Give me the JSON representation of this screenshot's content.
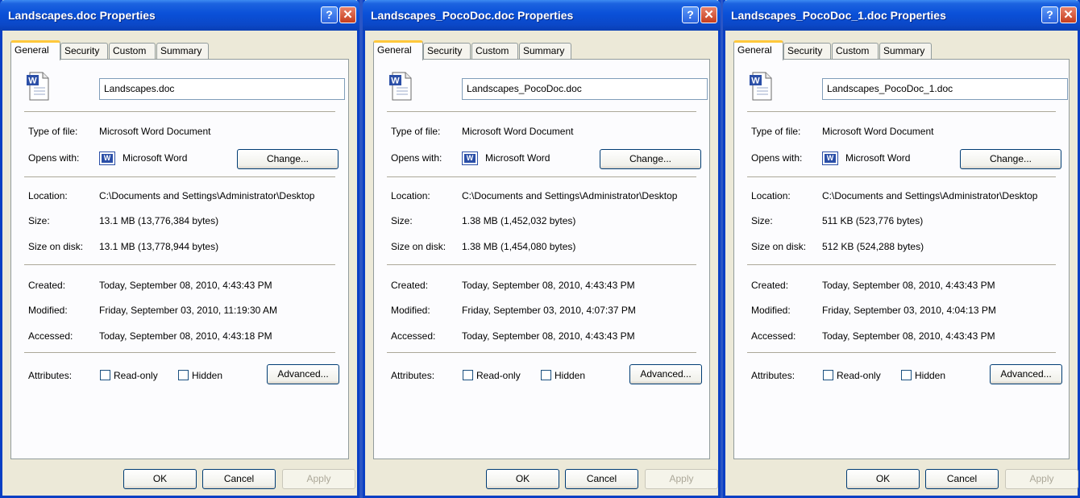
{
  "dialogs": [
    {
      "title": "Landscapes.doc Properties",
      "tabs": [
        "General",
        "Security",
        "Custom",
        "Summary"
      ],
      "file_name": "Landscapes.doc",
      "labels": {
        "type": "Type of file:",
        "opens": "Opens with:",
        "location": "Location:",
        "size": "Size:",
        "size_on_disk": "Size on disk:",
        "created": "Created:",
        "modified": "Modified:",
        "accessed": "Accessed:",
        "attributes": "Attributes:"
      },
      "type_of_file": "Microsoft Word Document",
      "opens_with": "Microsoft Word",
      "change_button": "Change...",
      "location": "C:\\Documents and Settings\\Administrator\\Desktop",
      "size": "13.1 MB (13,776,384 bytes)",
      "size_on_disk": "13.1 MB (13,778,944 bytes)",
      "created": "Today, September 08, 2010, 4:43:43 PM",
      "modified": "Friday, September 03, 2010, 11:19:30 AM",
      "accessed": "Today, September 08, 2010, 4:43:18 PM",
      "readonly_label": "Read-only",
      "hidden_label": "Hidden",
      "advanced_button": "Advanced...",
      "ok": "OK",
      "cancel": "Cancel",
      "apply": "Apply"
    },
    {
      "title": "Landscapes_PocoDoc.doc Properties",
      "tabs": [
        "General",
        "Security",
        "Custom",
        "Summary"
      ],
      "file_name": "Landscapes_PocoDoc.doc",
      "labels": {
        "type": "Type of file:",
        "opens": "Opens with:",
        "location": "Location:",
        "size": "Size:",
        "size_on_disk": "Size on disk:",
        "created": "Created:",
        "modified": "Modified:",
        "accessed": "Accessed:",
        "attributes": "Attributes:"
      },
      "type_of_file": "Microsoft Word Document",
      "opens_with": "Microsoft Word",
      "change_button": "Change...",
      "location": "C:\\Documents and Settings\\Administrator\\Desktop",
      "size": "1.38 MB (1,452,032 bytes)",
      "size_on_disk": "1.38 MB (1,454,080 bytes)",
      "created": "Today, September 08, 2010, 4:43:43 PM",
      "modified": "Friday, September 03, 2010, 4:07:37 PM",
      "accessed": "Today, September 08, 2010, 4:43:43 PM",
      "readonly_label": "Read-only",
      "hidden_label": "Hidden",
      "advanced_button": "Advanced...",
      "ok": "OK",
      "cancel": "Cancel",
      "apply": "Apply"
    },
    {
      "title": "Landscapes_PocoDoc_1.doc Properties",
      "tabs": [
        "General",
        "Security",
        "Custom",
        "Summary"
      ],
      "file_name": "Landscapes_PocoDoc_1.doc",
      "labels": {
        "type": "Type of file:",
        "opens": "Opens with:",
        "location": "Location:",
        "size": "Size:",
        "size_on_disk": "Size on disk:",
        "created": "Created:",
        "modified": "Modified:",
        "accessed": "Accessed:",
        "attributes": "Attributes:"
      },
      "type_of_file": "Microsoft Word Document",
      "opens_with": "Microsoft Word",
      "change_button": "Change...",
      "location": "C:\\Documents and Settings\\Administrator\\Desktop",
      "size": "511 KB (523,776 bytes)",
      "size_on_disk": "512 KB (524,288 bytes)",
      "created": "Today, September 08, 2010, 4:43:43 PM",
      "modified": "Friday, September 03, 2010, 4:04:13 PM",
      "accessed": "Today, September 08, 2010, 4:43:43 PM",
      "readonly_label": "Read-only",
      "hidden_label": "Hidden",
      "advanced_button": "Advanced...",
      "ok": "OK",
      "cancel": "Cancel",
      "apply": "Apply"
    }
  ],
  "icons": {
    "help": "?",
    "close": "✕",
    "word_letter": "W"
  },
  "colors": {
    "titlebar": "#0a50d8",
    "dialog_bg": "#ece9d8",
    "panel_bg": "#fcfcfe",
    "tab_highlight": "#ffc83c",
    "button_border": "#003c74"
  }
}
